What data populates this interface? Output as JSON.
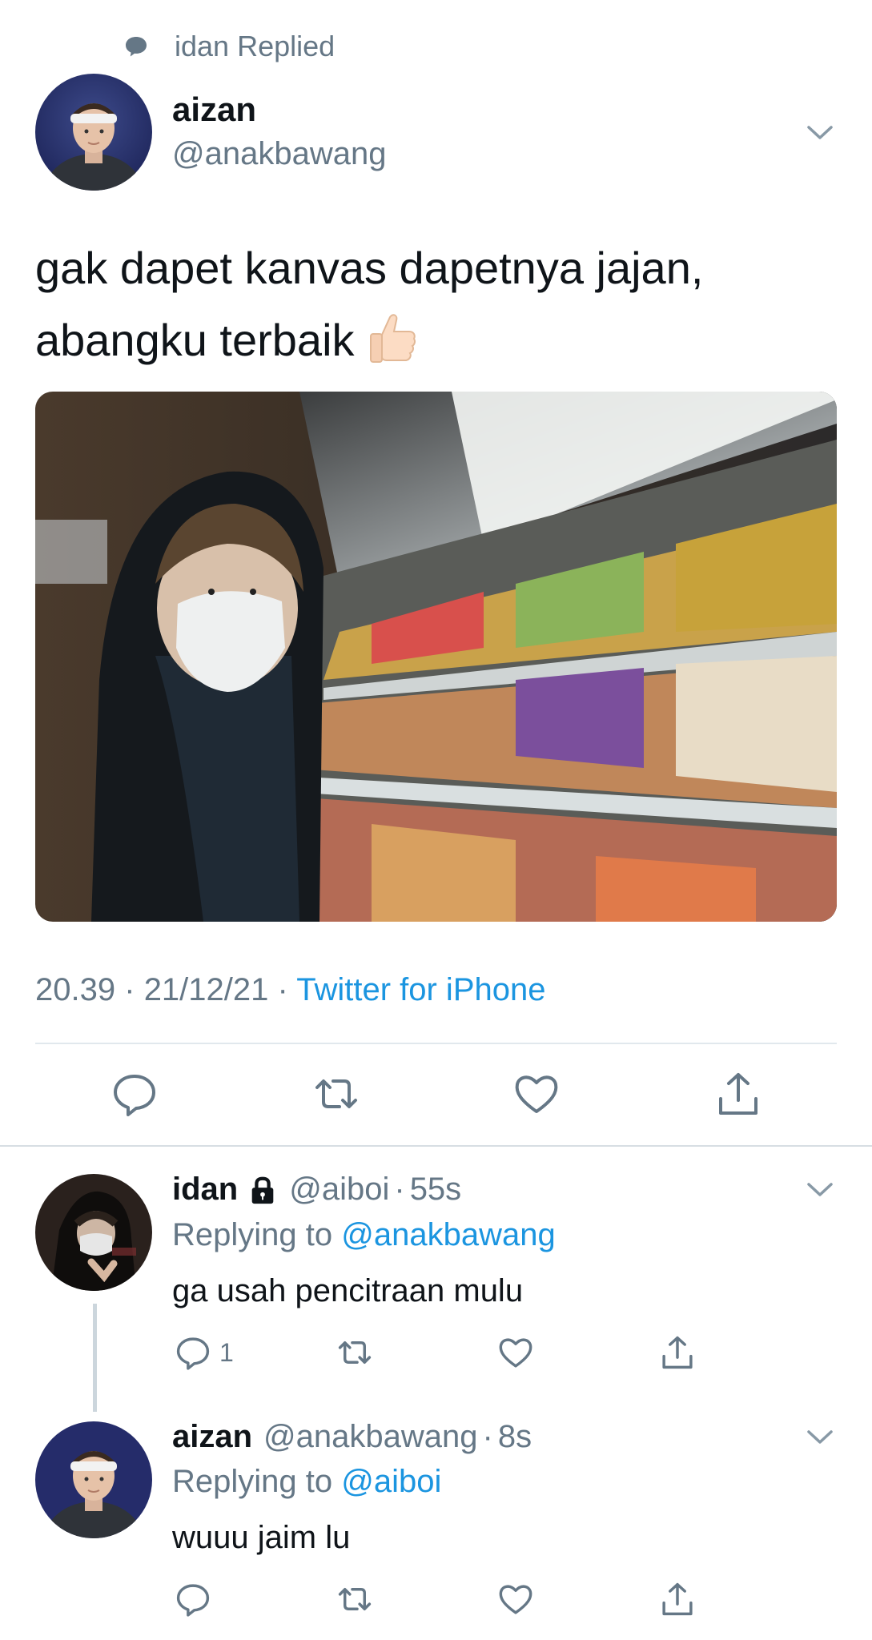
{
  "header": {
    "replied_label": "idan Replied"
  },
  "main_tweet": {
    "name": "aizan",
    "handle": "@anakbawang",
    "text_line1": "gak dapet kanvas dapetnya jajan,",
    "text_line2": "abangku terbaik",
    "emoji": "thumbs-up",
    "time": "20.39",
    "date": "21/12/21",
    "separator": "·",
    "source": "Twitter for iPhone"
  },
  "replies": [
    {
      "name": "idan",
      "handle": "@aiboi",
      "sep": "·",
      "time": "55s",
      "replying_prefix": "Replying to",
      "replying_to": "@anakbawang",
      "text": "ga usah pencitraan mulu",
      "reply_count": "1"
    },
    {
      "name": "aizan",
      "handle": "@anakbawang",
      "sep": "·",
      "time": "8s",
      "replying_prefix": "Replying to",
      "replying_to": "@aiboi",
      "text": "wuuu jaim lu"
    }
  ],
  "icons": {
    "reply": "reply-icon",
    "retweet": "retweet-icon",
    "like": "heart-icon",
    "share": "share-icon",
    "lock": "lock-icon",
    "chevron": "chevron-down-icon"
  },
  "colors": {
    "link": "#1b95e0",
    "secondary_text": "#657786",
    "divider": "#e1e8ed"
  }
}
